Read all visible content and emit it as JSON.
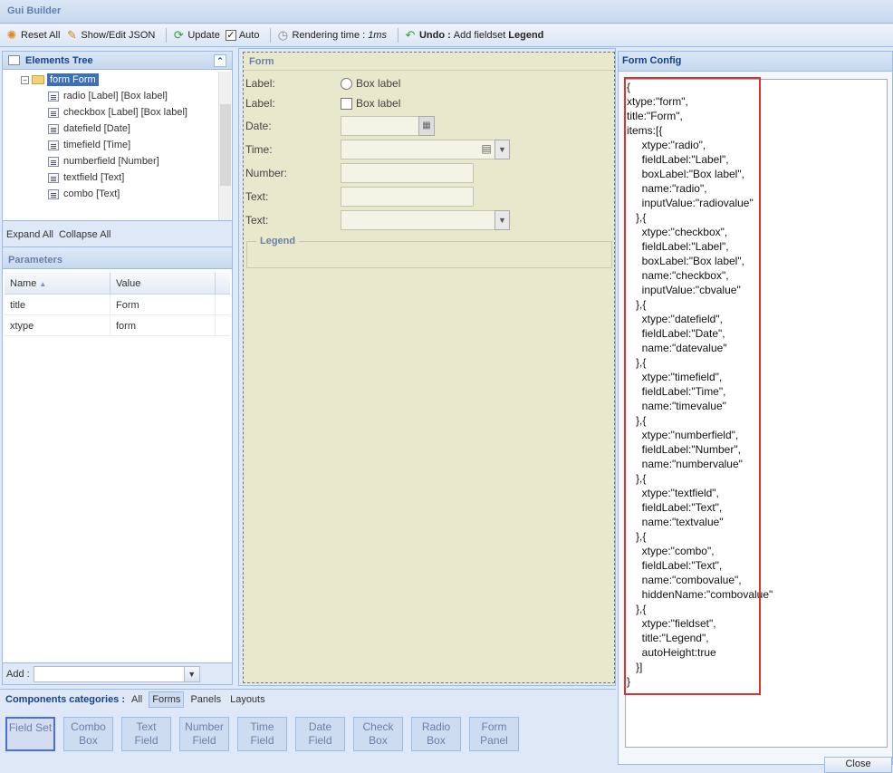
{
  "app": {
    "title": "Gui Builder"
  },
  "toolbar": {
    "reset": "Reset All",
    "show_edit_json": "Show/Edit JSON",
    "update": "Update",
    "auto": "Auto",
    "rendering_label": "Rendering time :",
    "rendering_value": "1ms",
    "undo_label": "Undo :",
    "undo_action": "Add fieldset",
    "undo_target": "Legend"
  },
  "elements_tree": {
    "title": "Elements Tree",
    "root": "form Form",
    "items": [
      "radio [Label] [Box label]",
      "checkbox [Label] [Box label]",
      "datefield [Date]",
      "timefield [Time]",
      "numberfield [Number]",
      "textfield [Text]",
      "combo [Text]"
    ],
    "expand_all": "Expand All",
    "collapse_all": "Collapse All"
  },
  "parameters": {
    "title": "Parameters",
    "columns": [
      "Name",
      "Value"
    ],
    "rows": [
      [
        "title",
        "Form"
      ],
      [
        "xtype",
        "form"
      ]
    ]
  },
  "add": {
    "label": "Add :",
    "value": ""
  },
  "form": {
    "title": "Form",
    "rows": [
      {
        "label": "Label:",
        "box_label": "Box label"
      },
      {
        "label": "Label:",
        "box_label": "Box label"
      },
      {
        "label": "Date:"
      },
      {
        "label": "Time:"
      },
      {
        "label": "Number:"
      },
      {
        "label": "Text:"
      },
      {
        "label": "Text:"
      }
    ],
    "legend": "Legend"
  },
  "form_config": {
    "title": "Form Config",
    "json_text": "{\nxtype:\"form\",\ntitle:\"Form\",\nitems:[{\n     xtype:\"radio\",\n     fieldLabel:\"Label\",\n     boxLabel:\"Box label\",\n     name:\"radio\",\n     inputValue:\"radiovalue\"\n   },{\n     xtype:\"checkbox\",\n     fieldLabel:\"Label\",\n     boxLabel:\"Box label\",\n     name:\"checkbox\",\n     inputValue:\"cbvalue\"\n   },{\n     xtype:\"datefield\",\n     fieldLabel:\"Date\",\n     name:\"datevalue\"\n   },{\n     xtype:\"timefield\",\n     fieldLabel:\"Time\",\n     name:\"timevalue\"\n   },{\n     xtype:\"numberfield\",\n     fieldLabel:\"Number\",\n     name:\"numbervalue\"\n   },{\n     xtype:\"textfield\",\n     fieldLabel:\"Text\",\n     name:\"textvalue\"\n   },{\n     xtype:\"combo\",\n     fieldLabel:\"Text\",\n     name:\"combovalue\",\n     hiddenName:\"combovalue\"\n   },{\n     xtype:\"fieldset\",\n     title:\"Legend\",\n     autoHeight:true\n   }]\n}",
    "close": "Close"
  },
  "components": {
    "label": "Components categories :",
    "categories": [
      "All",
      "Forms",
      "Panels",
      "Layouts"
    ],
    "active": "Forms",
    "buttons": [
      [
        "Field Set",
        ""
      ],
      [
        "Combo",
        "Box"
      ],
      [
        "Text",
        "Field"
      ],
      [
        "Number",
        "Field"
      ],
      [
        "Time",
        "Field"
      ],
      [
        "Date",
        "Field"
      ],
      [
        "Check",
        "Box"
      ],
      [
        "Radio",
        "Box"
      ],
      [
        "Form",
        "Panel"
      ]
    ]
  },
  "colors": {
    "accent": "#15428b",
    "highlight_border": "#e03131",
    "selected": "#4a6fd6"
  }
}
